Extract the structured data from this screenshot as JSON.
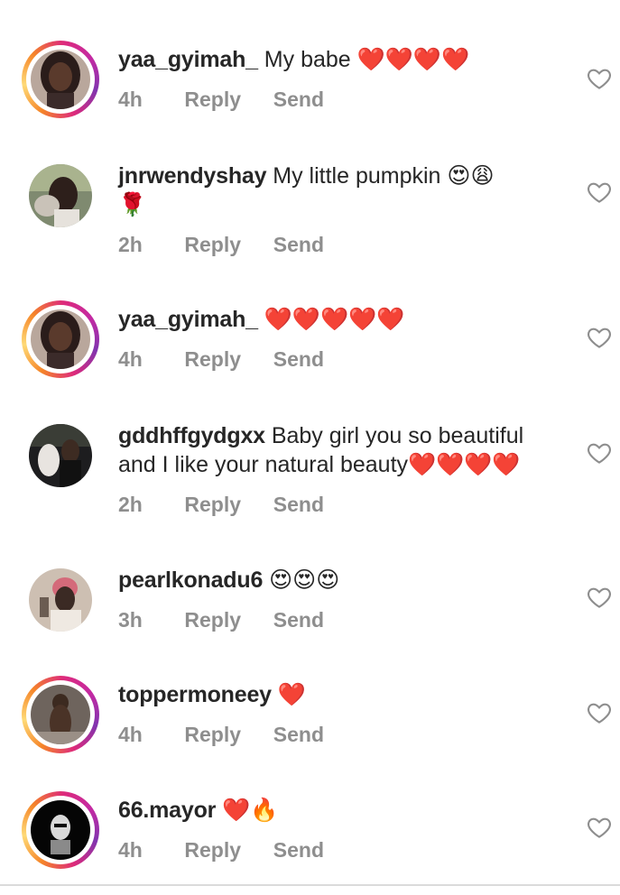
{
  "comments": [
    {
      "username": "yaa_gyimah_",
      "text": "My babe",
      "emoji": "❤️❤️❤️❤️",
      "emoji2": "",
      "time": "4h",
      "reply": "Reply",
      "send": "Send"
    },
    {
      "username": "jnrwendyshay",
      "text": "My little pumpkin",
      "emoji": "😍😩",
      "emoji2": "🌹",
      "time": "2h",
      "reply": "Reply",
      "send": "Send"
    },
    {
      "username": "yaa_gyimah_",
      "text": "",
      "emoji": "❤️❤️❤️❤️❤️",
      "emoji2": "",
      "time": "4h",
      "reply": "Reply",
      "send": "Send"
    },
    {
      "username": "gddhffgydgxx",
      "text": "Baby girl you so beautiful",
      "text2": "and I like your natural beauty",
      "emoji": "❤️❤️❤️❤️",
      "time": "2h",
      "reply": "Reply",
      "send": "Send"
    },
    {
      "username": "pearlkonadu6",
      "text": "",
      "emoji": "😍😍😍",
      "time": "3h",
      "reply": "Reply",
      "send": "Send"
    },
    {
      "username": "toppermoneey",
      "text": "",
      "emoji": "❤️",
      "time": "4h",
      "reply": "Reply",
      "send": "Send"
    },
    {
      "username": "66.mayor",
      "text": "",
      "emoji": "❤️🔥",
      "time": "4h",
      "reply": "Reply",
      "send": "Send"
    }
  ],
  "colors": {
    "text": "#262626",
    "meta": "#8e8e8e",
    "heart": "#ed1c24",
    "story_ring_start": "#f58529",
    "story_ring_end": "#c32aa3"
  },
  "icons": {
    "like": "heart-outline-icon"
  }
}
